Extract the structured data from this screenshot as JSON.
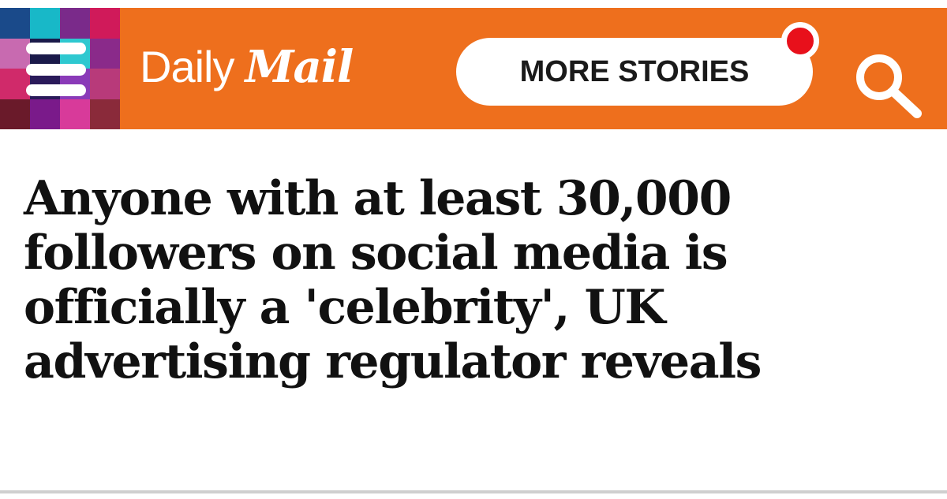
{
  "header": {
    "background_color": "#ee6f1d",
    "menu_icon": "hamburger-menu-icon",
    "menu_tiles": [
      "#1a4a8a",
      "#18b8c8",
      "#7a2a8a",
      "#d01a5a",
      "#c86ab0",
      "#1a1a4a",
      "#2ec8d0",
      "#8a2a8a",
      "#d02a6a",
      "#2a1a5a",
      "#8a3ab8",
      "#b83a7a",
      "#6a1a2a",
      "#7a1a8a",
      "#d83a9a",
      "#8a2a3a"
    ],
    "logo": {
      "daily": "Daily",
      "mail": "Mail"
    },
    "more_stories_label": "MORE STORIES",
    "notification_color": "#e8101b",
    "search_icon": "search-icon"
  },
  "article": {
    "headline_lines": [
      "Anyone with at least 30,000",
      "followers on social media is",
      "officially a 'celebrity', UK",
      "advertising regulator reveals"
    ]
  }
}
